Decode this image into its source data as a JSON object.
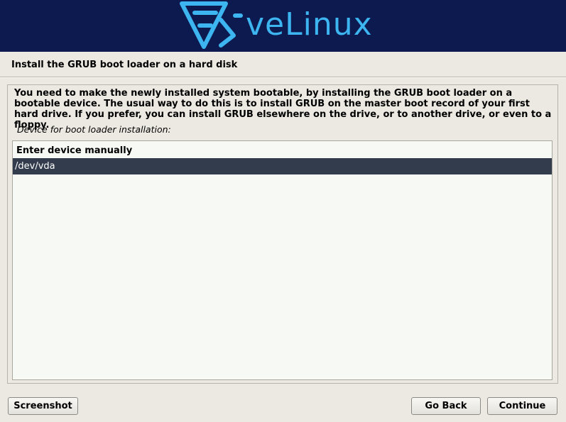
{
  "header": {
    "brand_text": "veLinux",
    "logo_icon": "velinux-logo-icon",
    "background_color": "#0c1a4f",
    "brand_color": "#3cb5f0"
  },
  "page": {
    "title": "Install the GRUB boot loader on a hard disk"
  },
  "main": {
    "description": "You need to make the newly installed system bootable, by installing the GRUB boot loader on a bootable device. The usual way to do this is to install GRUB on the master boot record of your first hard drive. If you prefer, you can install GRUB elsewhere on the drive, or to another drive, or even to a floppy.",
    "field_label": "Device for boot loader installation:",
    "options": [
      {
        "label": "Enter device manually",
        "selected": false
      },
      {
        "label": "/dev/vda",
        "selected": true
      }
    ],
    "selection_color": "#333c4c"
  },
  "footer": {
    "screenshot_label": "Screenshot",
    "back_label": "Go Back",
    "continue_label": "Continue"
  }
}
